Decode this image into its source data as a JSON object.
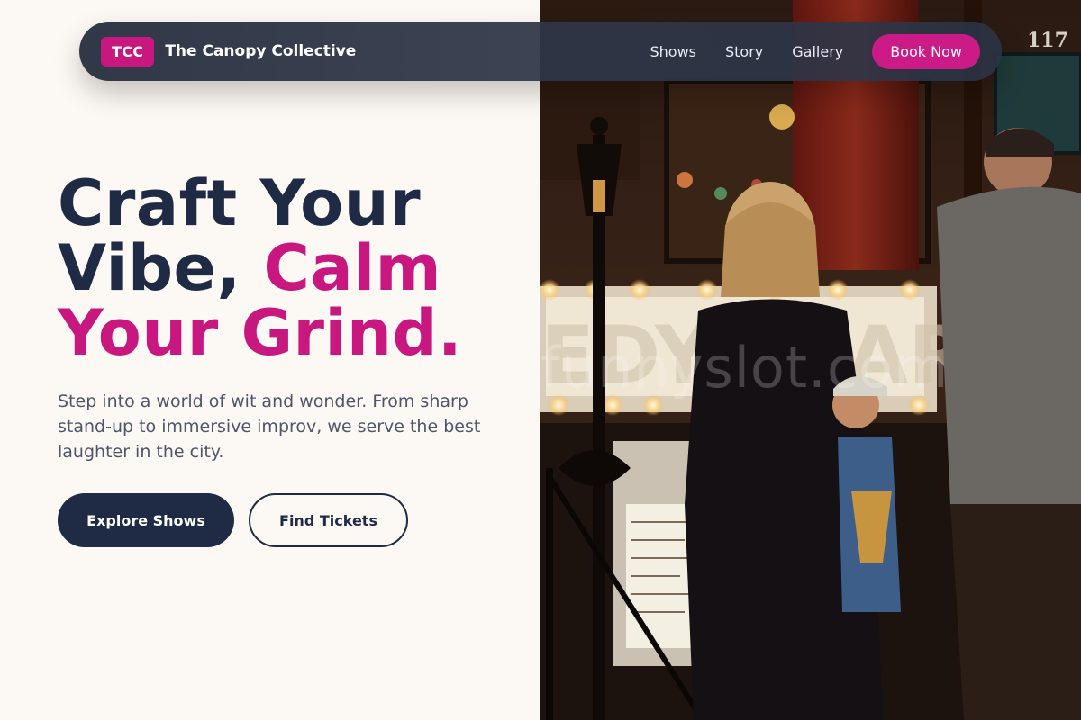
{
  "nav": {
    "brand_badge": "TCC",
    "brand_name": "The Canopy Collective",
    "links": [
      "Shows",
      "Story",
      "Gallery"
    ],
    "cta_label": "Book Now"
  },
  "hero": {
    "title_line1": "Craft Your",
    "title_line2_plain": "Vibe, ",
    "title_line2_accent": "Calm",
    "title_line3_accent": "Your Grind.",
    "subtitle": "Step into a world of wit and wonder. From sharp stand-up to immersive improv, we serve the best laughter in the city.",
    "primary_button": "Explore Shows",
    "secondary_button": "Find Tickets"
  },
  "photo": {
    "watermark": "funnyslot.com",
    "address_number": "117"
  },
  "colors": {
    "accent": "#c8187f",
    "navy": "#1f2a44",
    "background": "#fcf8f3"
  }
}
